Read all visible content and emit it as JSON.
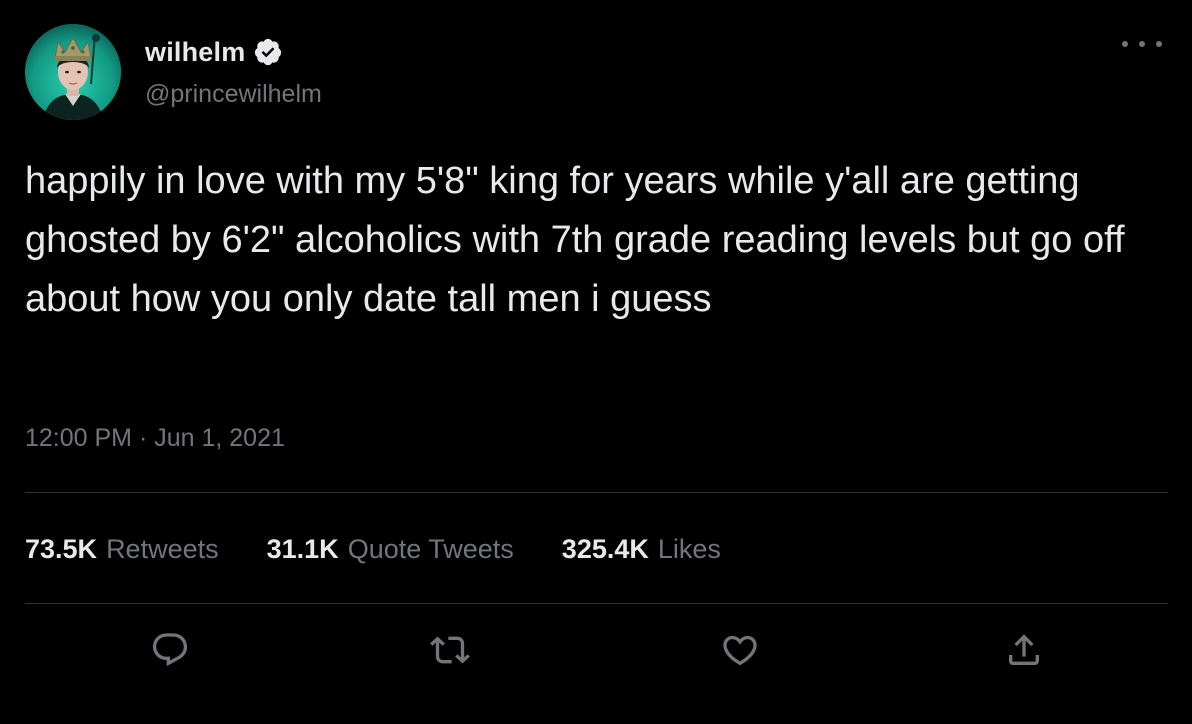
{
  "user": {
    "display_name": "wilhelm",
    "handle": "@princewilhelm",
    "verified": true
  },
  "tweet": {
    "text": "happily in love with my 5'8\" king for years while y'all are getting ghosted by 6'2\" alcoholics with 7th grade reading levels but go off about how you only date tall men i guess",
    "timestamp": "12:00 PM · Jun 1, 2021"
  },
  "stats": {
    "retweets_value": "73.5K",
    "retweets_label": "Retweets",
    "quotes_value": "31.1K",
    "quotes_label": "Quote Tweets",
    "likes_value": "325.4K",
    "likes_label": "Likes"
  },
  "actions": {
    "reply_icon": "reply-icon",
    "retweet_icon": "retweet-icon",
    "like_icon": "heart-icon",
    "share_icon": "share-icon",
    "more_icon": "more-icon"
  },
  "colors": {
    "background": "#000000",
    "primary_text": "#e7e9ea",
    "secondary_text": "#71767b",
    "divider": "#2f3336",
    "verified_badge": "#e7e9ea"
  }
}
